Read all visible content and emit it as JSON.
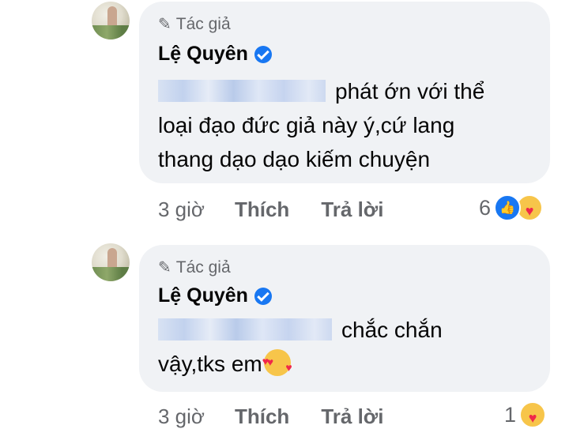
{
  "comments": [
    {
      "author_badge": "Tác giả",
      "author_name": "Lệ Quyên",
      "text_lines": [
        "phát ớn với thể",
        "loại đạo đức giả này ý,cứ lang",
        "thang dạo dạo kiếm chuyện"
      ],
      "time": "3 giờ",
      "like_label": "Thích",
      "reply_label": "Trả lời",
      "reaction_count": "6"
    },
    {
      "author_badge": "Tác giả",
      "author_name": "Lệ Quyên",
      "text_lines": [
        "chắc chắn",
        "vậy,tks em"
      ],
      "time": "3 giờ",
      "like_label": "Thích",
      "reply_label": "Trả lời",
      "reaction_count": "1"
    }
  ],
  "icons": {
    "pencil": "pencil-icon",
    "verified": "verified-badge-icon",
    "like": "like-reaction-icon",
    "care": "care-reaction-icon"
  },
  "colors": {
    "bubble": "#f0f2f5",
    "meta_text": "#65676b",
    "accent": "#1877f2"
  }
}
